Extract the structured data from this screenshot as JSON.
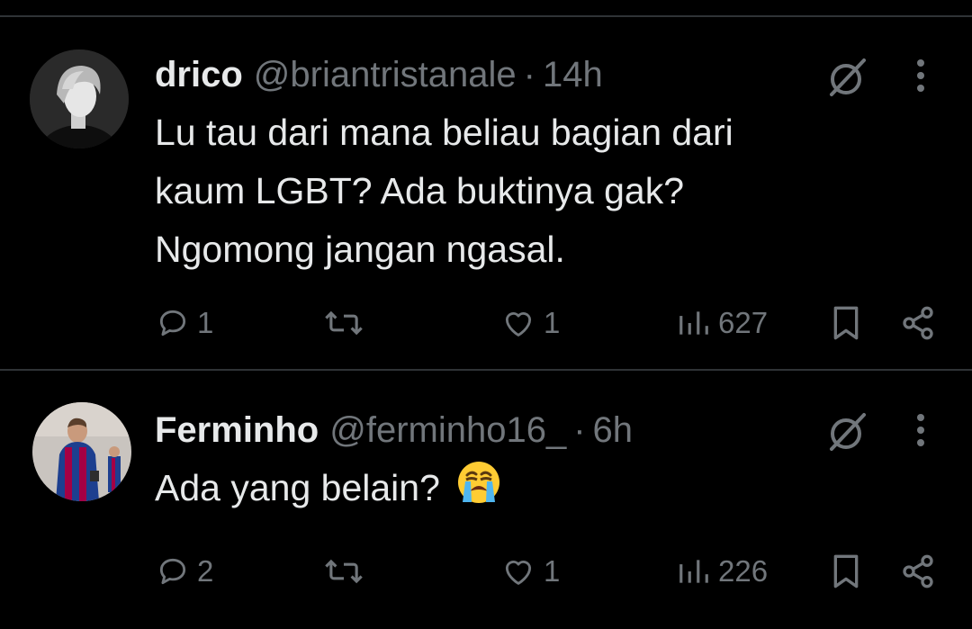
{
  "tweets": [
    {
      "name": "drico",
      "handle": "@briantristanale",
      "dot": "·",
      "time": "14h",
      "text_lines": [
        "Lu tau dari mana beliau bagian dari",
        "kaum LGBT? Ada buktinya gak?",
        "Ngomong jangan ngasal."
      ],
      "replies": "1",
      "likes": "1",
      "views": "627"
    },
    {
      "name": "Ferminho",
      "handle": "@ferminho16_",
      "dot": "·",
      "time": "6h",
      "text": "Ada yang belain?",
      "emoji_icon": "loudly-crying-face-emoji",
      "replies": "2",
      "likes": "1",
      "views": "226"
    }
  ],
  "icons": [
    "reply-icon",
    "retweet-icon",
    "like-icon",
    "views-icon",
    "bookmark-icon",
    "share-icon",
    "grok-icon",
    "more-icon"
  ],
  "colors": {
    "background": "#000000",
    "text": "#e7e9ea",
    "secondary": "#71767b",
    "divider": "#2f3336"
  }
}
